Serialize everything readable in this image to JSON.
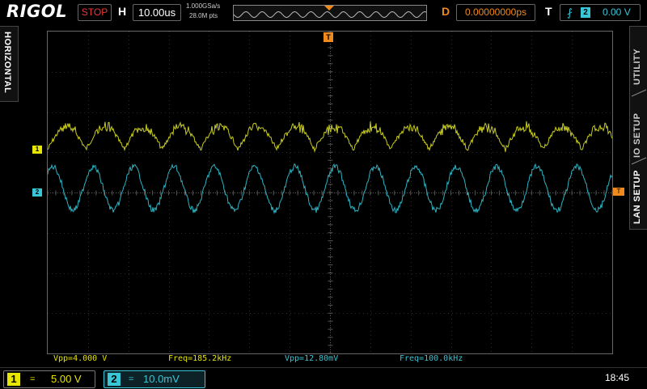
{
  "app": {
    "logo": "RIGOL",
    "run_state": "STOP"
  },
  "horizontal": {
    "letter": "H",
    "timebase": "10.00us",
    "sample_rate": "1.000GSa/s",
    "memory_depth": "28.0M pts"
  },
  "trigger_delay": {
    "letter": "D",
    "value": "0.00000000ps"
  },
  "trigger": {
    "letter": "T",
    "edge_icon": "rising-edge-icon",
    "source": "2",
    "level": "0.00 V"
  },
  "side_tabs": {
    "left": "HORIZONTAL",
    "right": [
      "UTILITY",
      "IO SETUP",
      "LAN SETUP"
    ]
  },
  "markers": {
    "ch1": "1",
    "ch2": "2",
    "trigger_level": "T",
    "trigger_position": "T"
  },
  "measurements": [
    {
      "label": "Vpp=4.000 V",
      "channel": 1
    },
    {
      "label": "Freq=185.2kHz",
      "channel": 1
    },
    {
      "label": "Vpp=12.80mV",
      "channel": 2
    },
    {
      "label": "Freq=100.0kHz",
      "channel": 2
    }
  ],
  "channels": [
    {
      "number": "1",
      "coupling": "=",
      "scale": "5.00 V",
      "color": "#e6e600"
    },
    {
      "number": "2",
      "coupling": "=",
      "scale": "10.0mV",
      "color": "#39c6d6"
    }
  ],
  "clock": "18:45",
  "colors": {
    "ch1": "#e6e600",
    "ch2": "#39c6d6",
    "trigger": "#f08a1c",
    "stop": "#e83a3a"
  }
}
